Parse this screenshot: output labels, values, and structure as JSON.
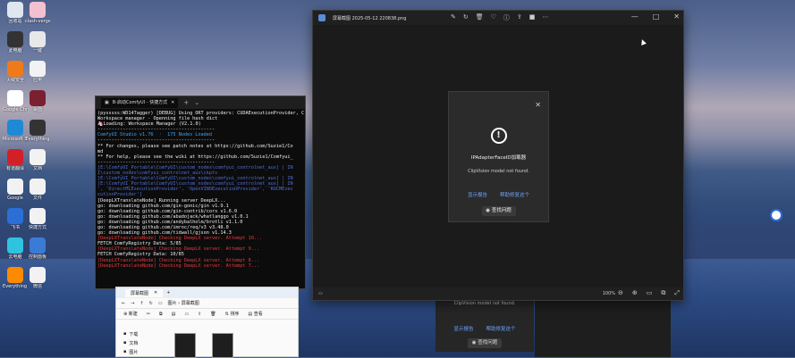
{
  "desktop": {
    "icons": [
      {
        "label": "回收站",
        "color": "#dfe6ee"
      },
      {
        "label": "clash-verge",
        "color": "#f3c0d0"
      },
      {
        "label": "此电脑",
        "color": "#333"
      },
      {
        "label": "一键",
        "color": "#e8e8e8"
      },
      {
        "label": "火绒安全",
        "color": "#f07a1a"
      },
      {
        "label": "应用",
        "color": "#f2f2f2"
      },
      {
        "label": "Google Chrome",
        "color": "#ffffff"
      },
      {
        "label": "桌面",
        "color": "#7a2030"
      },
      {
        "label": "Microsoft Edge",
        "color": "#1e8ad6"
      },
      {
        "label": "Everything",
        "color": "#333"
      },
      {
        "label": "有道翻译",
        "color": "#d32027"
      },
      {
        "label": "文档",
        "color": "#f2f2f2"
      },
      {
        "label": "Google",
        "color": "#f2f2f2"
      },
      {
        "label": "文件",
        "color": "#f2f2f2"
      },
      {
        "label": "飞书",
        "color": "#2b6ed6"
      },
      {
        "label": "快捷方式",
        "color": "#f2f2f2"
      },
      {
        "label": "云电脑",
        "color": "#2ec4e0"
      },
      {
        "label": "控制面板",
        "color": "#3a7bd5"
      },
      {
        "label": "Everything 搜索",
        "color": "#ff8a00"
      },
      {
        "label": "微信",
        "color": "#f2f2f2"
      }
    ]
  },
  "viewer": {
    "title": "屏幕截图 2025-05-12 220838.png",
    "zoom": "100%",
    "dialog": {
      "heading": "IPAdapterFaceID加载器",
      "message": "ClipVision model not found.",
      "link_report": "显示报告",
      "link_help": "帮助修复这个",
      "github_button": "查找问题"
    }
  },
  "dialog_behind": {
    "message": "ClipVision model not found.",
    "link_report": "显示报告",
    "link_help": "帮助修复这个",
    "github_button": "查找问题"
  },
  "terminal": {
    "tab_title": "B-启动ComfyUI - 快捷方式",
    "lines": [
      {
        "text": "(pysssss:WD14Tagger) [DEBUG] Using ORT providers: CUDAExecutionProvider, C",
        "cls": "c-white"
      },
      {
        "text": "Workspace manager - Openning file hash dict",
        "cls": "c-white"
      },
      {
        "text": "🦄Loading: Workspace Manager (V2.1.0)",
        "cls": "c-white"
      },
      {
        "text": "------------------------------------------",
        "cls": "c-white"
      },
      {
        "text": "ComfyUI Studio v1.76  ·  175 Nodes Loaded",
        "cls": "c-teal"
      },
      {
        "text": "------------------------------------------",
        "cls": "c-white"
      },
      {
        "text": "** For changes, please see patch notes at https://github.com/Suzie1/Co",
        "cls": "c-white"
      },
      {
        "text": "md",
        "cls": "c-white"
      },
      {
        "text": "** For help, please see the wiki at https://github.com/Suzie1/Comfyui_",
        "cls": "c-white"
      },
      {
        "text": "------------------------------------------",
        "cls": "c-white"
      },
      {
        "text": "[E:\\ComfyUI_Portable\\ComfyUI\\custom_nodes\\comfyui_controlnet_aux] | IN",
        "cls": "c-blue"
      },
      {
        "text": "I\\custom_nodes\\comfyui_controlnet_aux\\ckpts",
        "cls": "c-blue"
      },
      {
        "text": "[E:\\ComfyUI_Portable\\ComfyUI\\custom_nodes\\comfyui_controlnet_aux] | IN",
        "cls": "c-blue"
      },
      {
        "text": "[E:\\ComfyUI_Portable\\ComfyUI\\custom_nodes\\comfyui_controlnet_aux] | IN",
        "cls": "c-blue"
      },
      {
        "text": "', 'DirectMLExecutionProvider', 'OpenVINOExecutionProvider', 'ROCMExec",
        "cls": "c-blue"
      },
      {
        "text": "cutionProvider']",
        "cls": "c-blue"
      },
      {
        "text": "[DeepLXTranslateNode] Running server DeepLX...",
        "cls": "c-white"
      },
      {
        "text": "go: downloading github.com/gin-gonic/gin v1.9.1",
        "cls": "c-white"
      },
      {
        "text": "go: downloading github.com/gin-contrib/cors v1.6.0",
        "cls": "c-white"
      },
      {
        "text": "go: downloading github.com/abadojack/whatlanggo v1.0.1",
        "cls": "c-white"
      },
      {
        "text": "go: downloading github.com/andybalholm/brotli v1.1.0",
        "cls": "c-white"
      },
      {
        "text": "go: downloading github.com/imroc/req/v3 v3.48.0",
        "cls": "c-white"
      },
      {
        "text": "go: downloading github.com/tidwall/gjson v1.14.3",
        "cls": "c-white"
      },
      {
        "text": "[DeepLXTranslateNode] Checking DeepLX server. Attempt 10...",
        "cls": "c-red"
      },
      {
        "text": "FETCH ComfyRegistry Data: 5/85",
        "cls": "c-white"
      },
      {
        "text": "[DeepLXTranslateNode] Checking DeepLX server. Attempt 9...",
        "cls": "c-red"
      },
      {
        "text": "FETCH ComfyRegistry Data: 10/85",
        "cls": "c-white"
      },
      {
        "text": "[DeepLXTranslateNode] Checking DeepLX server. Attempt 8...",
        "cls": "c-red"
      },
      {
        "text": "[DeepLXTranslateNode] Checking DeepLX server. Attempt 7...",
        "cls": "c-red"
      }
    ]
  },
  "explorer": {
    "tab_title": "屏幕截图",
    "path": "图片 › 屏幕截图",
    "new_label": "新建",
    "sort_label": "排序",
    "view_label": "查看",
    "sidebar": [
      "下载",
      "文档",
      "图片"
    ]
  }
}
